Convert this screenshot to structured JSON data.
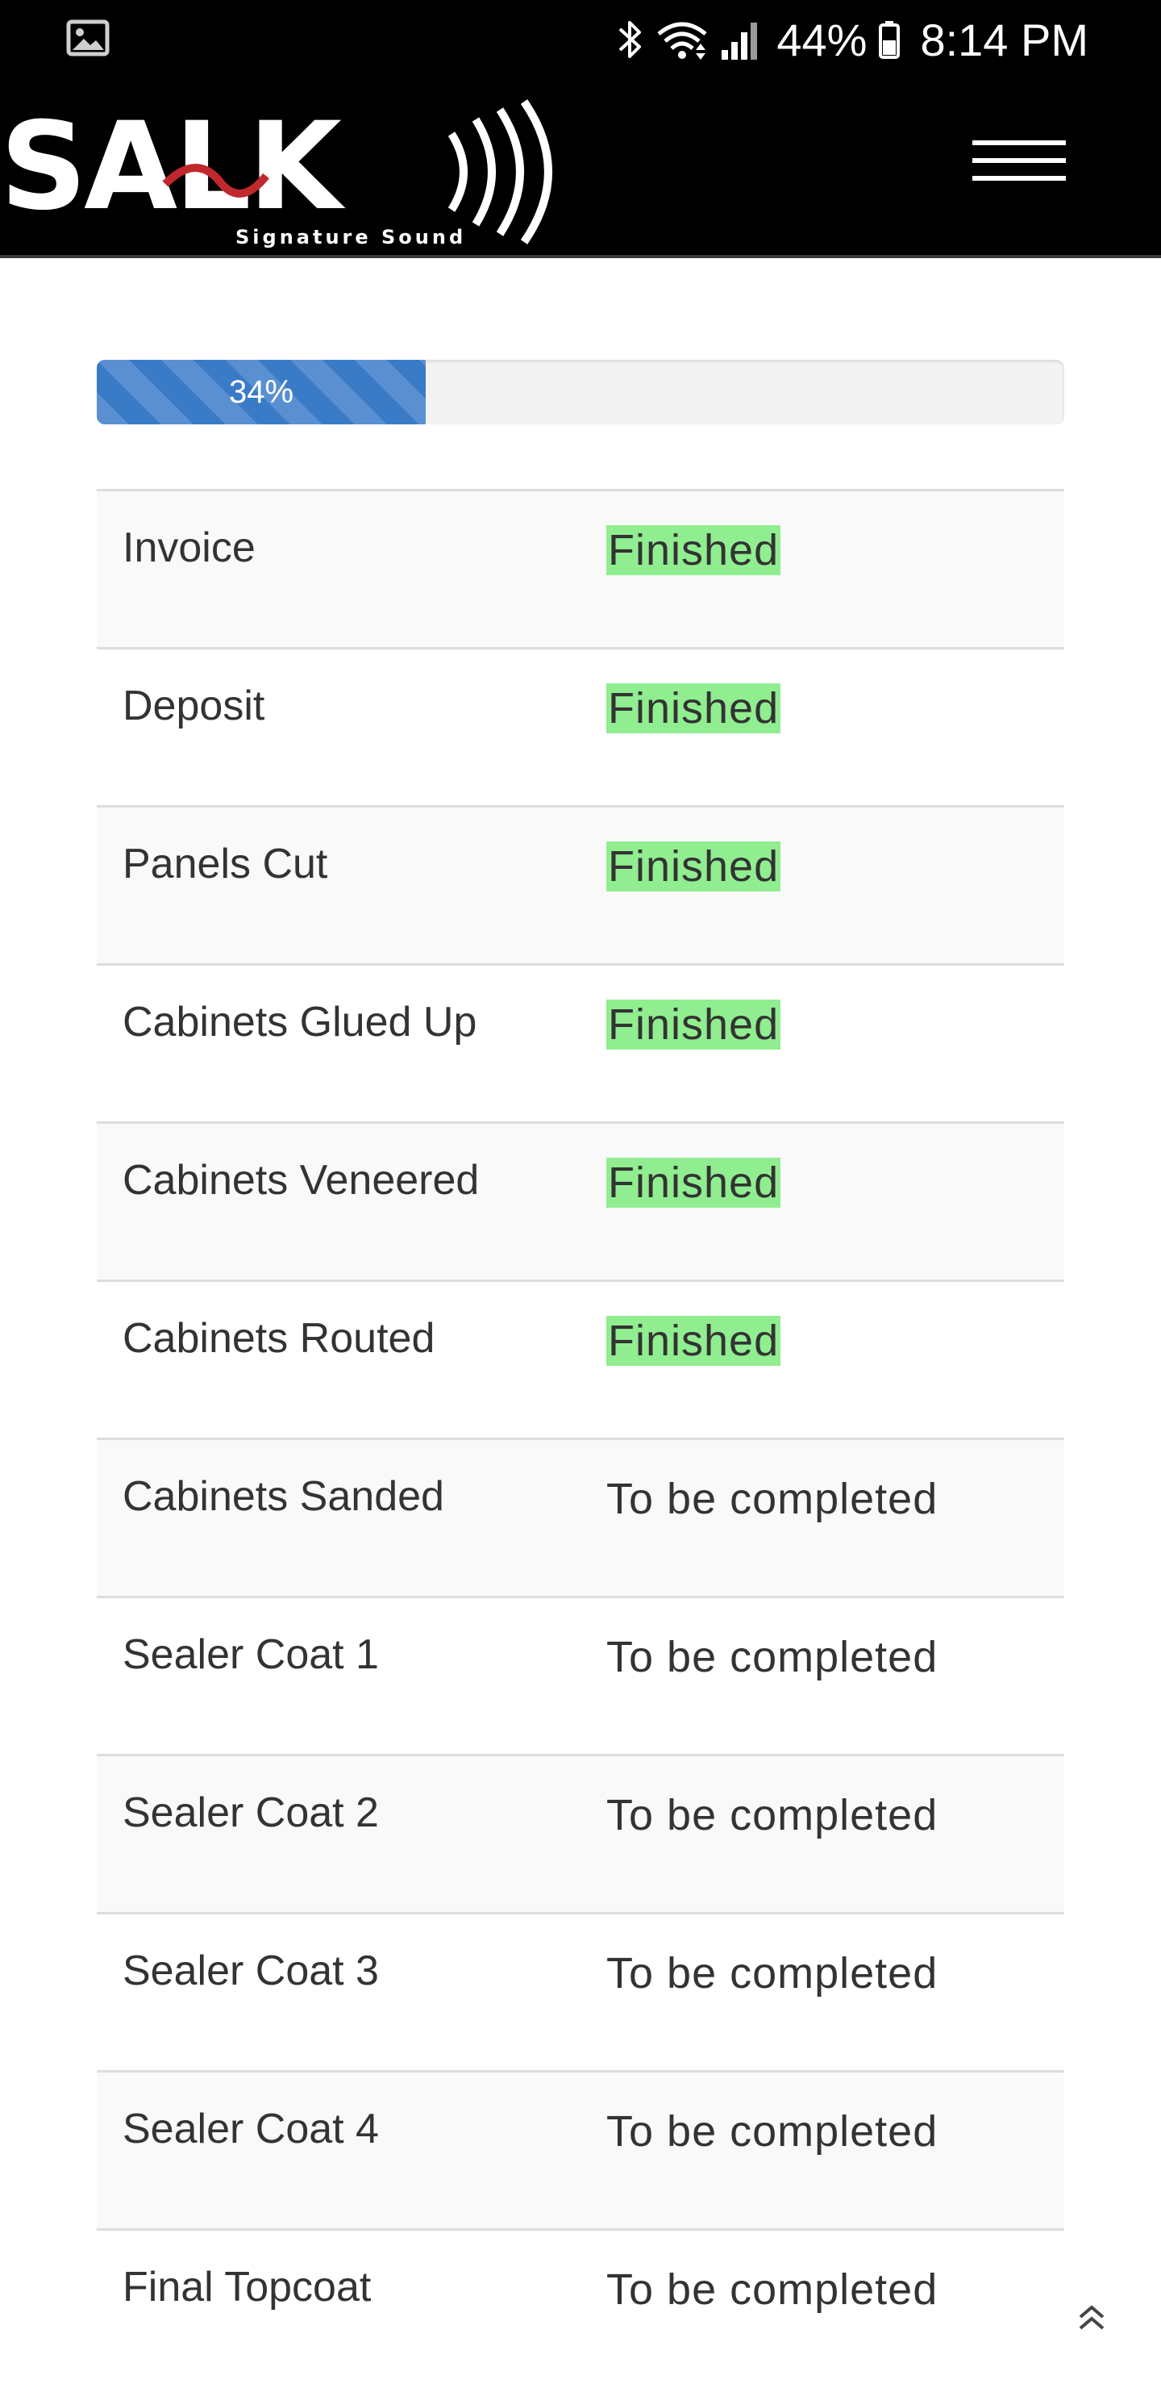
{
  "status_bar": {
    "battery_percent": "44%",
    "time": "8:14 PM",
    "icons": [
      "image-icon",
      "bluetooth-icon",
      "wifi-icon",
      "signal-icon",
      "battery-icon"
    ]
  },
  "header": {
    "logo_text": "SALK",
    "logo_subtext": "Signature Sound",
    "menu_icon": "hamburger-menu-icon"
  },
  "progress": {
    "value_percent": 34,
    "label": "34%",
    "color": "#3a7bc8"
  },
  "steps": [
    {
      "name": "Invoice",
      "status": "Finished"
    },
    {
      "name": "Deposit",
      "status": "Finished"
    },
    {
      "name": "Panels Cut",
      "status": "Finished"
    },
    {
      "name": "Cabinets Glued Up",
      "status": "Finished"
    },
    {
      "name": "Cabinets Veneered",
      "status": "Finished"
    },
    {
      "name": "Cabinets Routed",
      "status": "Finished"
    },
    {
      "name": "Cabinets Sanded",
      "status": "To be completed"
    },
    {
      "name": "Sealer Coat 1",
      "status": "To be completed"
    },
    {
      "name": "Sealer Coat 2",
      "status": "To be completed"
    },
    {
      "name": "Sealer Coat 3",
      "status": "To be completed"
    },
    {
      "name": "Sealer Coat 4",
      "status": "To be completed"
    },
    {
      "name": "Final Topcoat",
      "status": "To be completed"
    }
  ],
  "colors": {
    "finished_highlight": "#90ee90",
    "header_background": "#000000"
  },
  "back_to_top_icon": "double-chevron-up-icon"
}
